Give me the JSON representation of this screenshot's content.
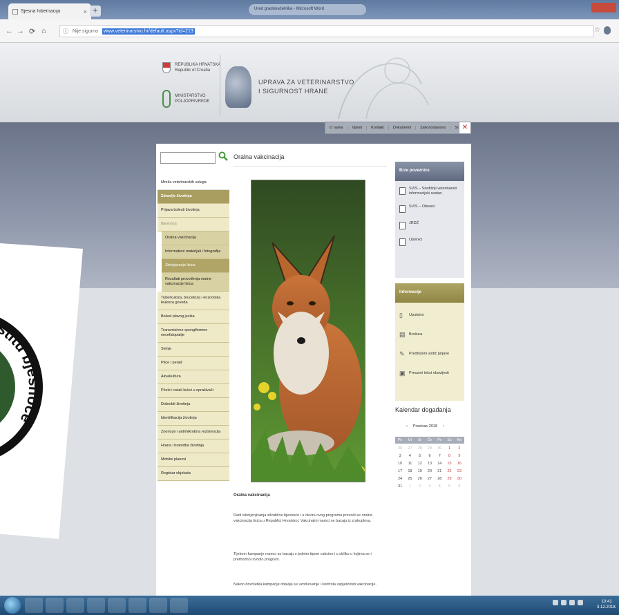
{
  "browser": {
    "tab_title": "Sjesna hibernacija",
    "tab_close": "×",
    "new_tab": "+",
    "window_title_strip": "Ured gradonačelnika - Microsoft Word",
    "omnibox_insecure": "Nije sigurno",
    "url": "www.veterinarstvo.hr/default.aspx?id=213",
    "nav": {
      "back": "←",
      "forward": "→",
      "reload": "⟳",
      "home": "⌂"
    },
    "star": "☆"
  },
  "header": {
    "logo_rh_line1": "REPUBLIKA HRVATSKA",
    "logo_rh_line2": "Republic of Croatia",
    "logo_ministry_line1": "MINISTARSTVO",
    "logo_ministry_line2": "POLJOPRIVREDE",
    "logo_uvsh_line1": "UPRAVA ZA VETERINARSTVO",
    "logo_uvsh_line2": "I SIGURNOST HRANE"
  },
  "topnav": [
    "O nama",
    "Vijesti",
    "Kontakt",
    "Dokumenti",
    "Zakonodavstvo",
    "SIFE"
  ],
  "search": {
    "value": "",
    "icon": "search-icon"
  },
  "leftnav": [
    {
      "label": "Mreža veterinarskih usluga",
      "kind": "top"
    },
    {
      "label": "Zdravlje životinja",
      "kind": "hd"
    },
    {
      "label": "Prijava bolesti životinja",
      "kind": "nv"
    },
    {
      "label": "Bjesnoća",
      "kind": "muted"
    },
    {
      "label": "Oralna vakcinacija",
      "kind": "sub"
    },
    {
      "label": "Informativni materijali i fotografije",
      "kind": "sub"
    },
    {
      "label": "Zbrinjavanje lisica",
      "kind": "subact"
    },
    {
      "label": "Rezultati provođenja oralne vakcinacije lisica",
      "kind": "sub"
    },
    {
      "label": "Tuberkuloza, bruceloza i enzootska leukoza goveda",
      "kind": "nv"
    },
    {
      "label": "Bolest plavog jezika",
      "kind": "nv"
    },
    {
      "label": "Transmisivne spongiformne encefalopatije",
      "kind": "nv"
    },
    {
      "label": "Svinje",
      "kind": "nv"
    },
    {
      "label": "Ptice i perad",
      "kind": "nv"
    },
    {
      "label": "Akvakultura",
      "kind": "nv"
    },
    {
      "label": "Pčele i ostali kukci u oprašivači",
      "kind": "nv"
    },
    {
      "label": "Dobrobit životinja",
      "kind": "nv"
    },
    {
      "label": "Identifikacija životinja",
      "kind": "nv"
    },
    {
      "label": "Zoonoze i antimikrobna rezistencija",
      "kind": "nv"
    },
    {
      "label": "Hrana i hranidba životinja",
      "kind": "nv"
    },
    {
      "label": "Mobilni planovi",
      "kind": "nv"
    },
    {
      "label": "Registar objekata",
      "kind": "nv"
    }
  ],
  "main": {
    "title": "Oralna vakcinacija",
    "caption": "Oralna vakcinacija",
    "paragraphs": [
      "Radi iskorjenjivanja silvatične bjesnoće i u okviru ovog programa provodi se oralna vakcinacija lisica u Republici Hrvatskoj. Vakcinalni mamci se bacaju iz zrakoplova.",
      "Tijekom kampanje mamci se bacaju s jednim tipom vakcine i u obliku u kojima se i prethodno izvodio program.",
      "Nakon dovršetka kampanje obavlja se uzorkovanje i kontrola uspješnosti vakcinacije."
    ]
  },
  "sidebar": {
    "box1_title": "Brze poveznice",
    "box1_items": [
      {
        "label": "SVIS – Središnji veterinarski informacijski sustav",
        "icon": "document-icon"
      },
      {
        "label": "SVIS – Obrasci",
        "icon": "document-icon"
      },
      {
        "label": "JRDŽ",
        "icon": "document-icon"
      },
      {
        "label": "Upisnici",
        "icon": "document-icon"
      }
    ],
    "box2_title": "Informacije",
    "box2_items": [
      {
        "label": "Uputstvo",
        "icon": "phone-icon"
      },
      {
        "label": "Brošura",
        "icon": "page-icon"
      },
      {
        "label": "Predloženi vodič prijave",
        "icon": "pen-icon"
      },
      {
        "label": "Preuzmi tekst obavijesti",
        "icon": "lock-icon"
      }
    ],
    "calendar_title": "Kalendar događanja",
    "calendar_nav": {
      "prev": "‹",
      "month": "Prosinac 2018",
      "next": "›"
    },
    "calendar_dow": [
      "Po",
      "Ut",
      "Sr",
      "Če",
      "Pe",
      "Su",
      "Ne"
    ],
    "calendar_weeks": [
      [
        "26",
        "27",
        "28",
        "29",
        "30",
        "1",
        "2"
      ],
      [
        "3",
        "4",
        "5",
        "6",
        "7",
        "8",
        "9"
      ],
      [
        "10",
        "11",
        "12",
        "13",
        "14",
        "15",
        "16"
      ],
      [
        "17",
        "18",
        "19",
        "20",
        "21",
        "22",
        "23"
      ],
      [
        "24",
        "25",
        "26",
        "27",
        "28",
        "29",
        "30"
      ],
      [
        "31",
        "1",
        "2",
        "3",
        "4",
        "5",
        "6"
      ]
    ]
  },
  "sticker": {
    "text": "zaštitu bjesnoće",
    "ring_color": "#111111",
    "center_color": "#2e5a2e"
  },
  "taskbar": {
    "clock_time": "10:41",
    "clock_date": "3.12.2018."
  },
  "colors": {
    "nav_olive": "#a99e5f",
    "nav_light": "#eeeac8",
    "band_gray": "#7d8699",
    "calendar_weekend": "#c43a3a"
  }
}
